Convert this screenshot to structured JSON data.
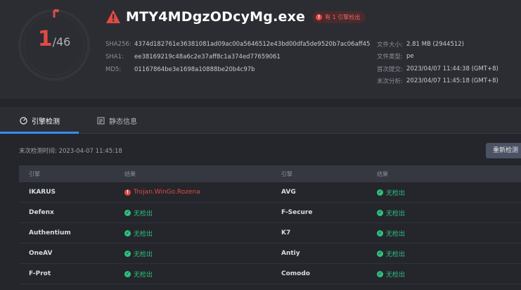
{
  "summary": {
    "detected": "1",
    "total": "/46",
    "detected_count": 1,
    "total_count": 46
  },
  "file": {
    "name": "MTY4MDgzODcyMg.exe",
    "badge": "有 1 引擎检出",
    "sha256_label": "SHA256:",
    "sha256": "4374d182761e36381081ad09ac00a5646512e43bd00dfa5de9520b7ac06aff45",
    "sha1_label": "SHA1:",
    "sha1": "ee38169219c48a6c2e37aff8c1a374ed77659061",
    "md5_label": "MD5:",
    "md5": "01167864be3e1698a10888be20b4c97b"
  },
  "meta": {
    "size_label": "文件大小:",
    "size": "2.81 MB (2944512)",
    "type_label": "文件类型:",
    "type": "pe",
    "first_label": "首次提交:",
    "first": "2023/04/07 11:44:38 (GMT+8)",
    "last_label": "末次分析:",
    "last": "2023/04/07 11:45:18 (GMT+8)"
  },
  "tabs": [
    {
      "label": "引擎检测",
      "icon": "gauge-icon"
    },
    {
      "label": "静态信息",
      "icon": "document-icon"
    }
  ],
  "scan": {
    "last_time": "末次检测时间: 2023-04-07 11:45:18",
    "rescan_label": "重新检测"
  },
  "table": {
    "headers": [
      "引擎",
      "结果",
      "引擎",
      "结果"
    ],
    "rows": [
      {
        "e1": "IKARUS",
        "r1": "Trojan.WinGo.Rozena",
        "r1_status": "malicious",
        "e2": "AVG",
        "r2": "无检出",
        "r2_status": "clean"
      },
      {
        "e1": "Defenx",
        "r1": "无检出",
        "r1_status": "clean",
        "e2": "F-Secure",
        "r2": "无检出",
        "r2_status": "clean"
      },
      {
        "e1": "Authentium",
        "r1": "无检出",
        "r1_status": "clean",
        "e2": "K7",
        "r2": "无检出",
        "r2_status": "clean"
      },
      {
        "e1": "OneAV",
        "r1": "无检出",
        "r1_status": "clean",
        "e2": "Antiy",
        "r2": "无检出",
        "r2_status": "clean"
      },
      {
        "e1": "F-Prot",
        "r1": "无检出",
        "r1_status": "clean",
        "e2": "Comodo",
        "r2": "无检出",
        "r2_status": "clean"
      }
    ]
  },
  "colors": {
    "danger": "#e14a43",
    "clean": "#2fc07e",
    "accent": "#3b8cf0"
  }
}
